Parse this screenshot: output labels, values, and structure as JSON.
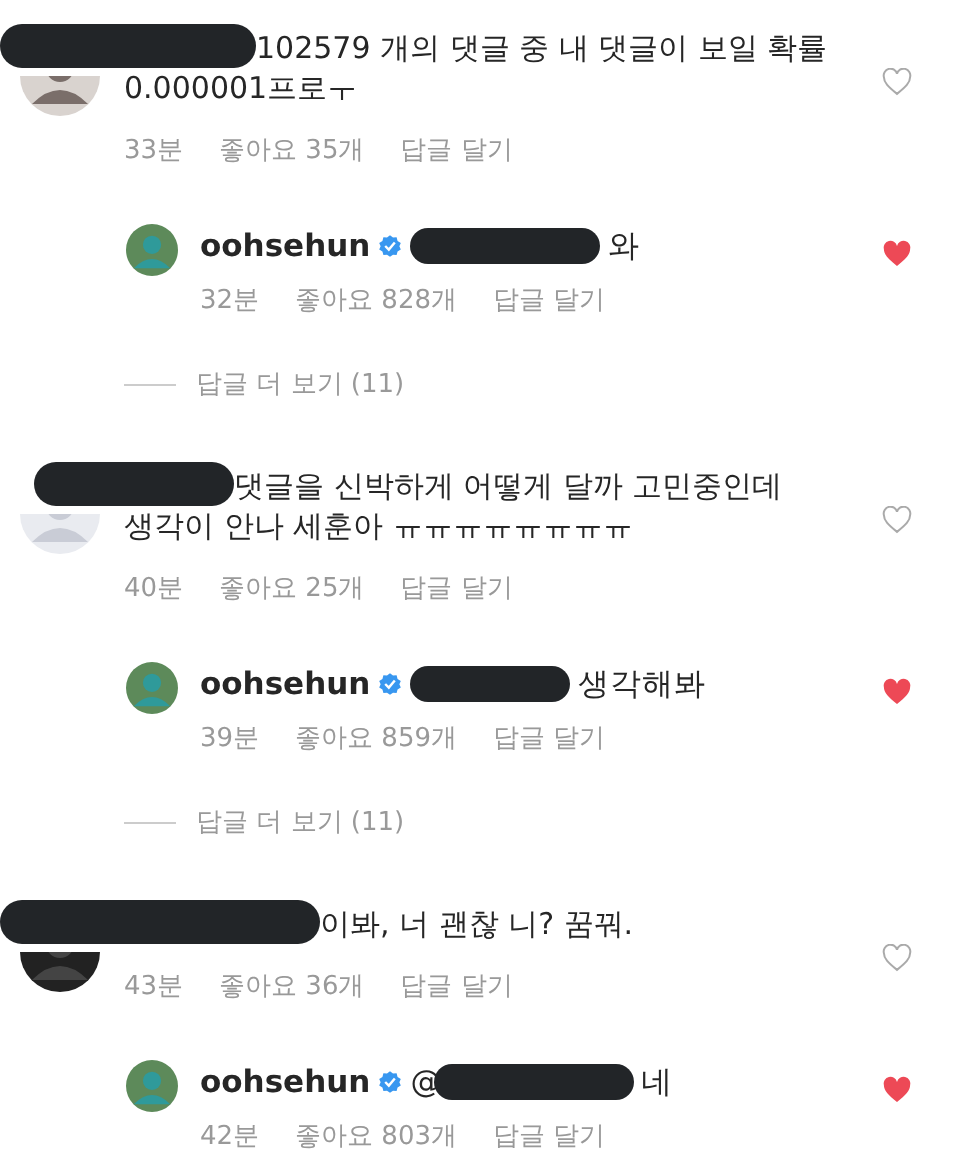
{
  "threads": [
    {
      "comment": {
        "text": "102579 개의 댓글 중 내 댓글이 보일 확률 0.000001프로ㅜ",
        "time": "33분",
        "likes": "좋아요 35개",
        "reply_label": "답글 달기",
        "liked": false
      },
      "reply": {
        "username": "oohsehun",
        "verified": true,
        "text": "와",
        "time": "32분",
        "likes": "좋아요 828개",
        "reply_label": "답글 달기",
        "liked": true
      },
      "more_replies": "답글 더 보기 (11)"
    },
    {
      "comment": {
        "text": "댓글을 신박하게 어떻게 달까 고민중인데 생각이 안나 세훈아 ㅠㅠㅠㅠㅠㅠㅠㅠ",
        "time": "40분",
        "likes": "좋아요 25개",
        "reply_label": "답글 달기",
        "liked": false
      },
      "reply": {
        "username": "oohsehun",
        "verified": true,
        "text": "생각해봐",
        "time": "39분",
        "likes": "좋아요 859개",
        "reply_label": "답글 달기",
        "liked": true
      },
      "more_replies": "답글 더 보기 (11)"
    },
    {
      "comment": {
        "text": "이봐, 너 괜찮 니? 꿈꿔.",
        "time": "43분",
        "likes": "좋아요 36개",
        "reply_label": "답글 달기",
        "liked": false
      },
      "reply": {
        "username": "oohsehun",
        "verified": true,
        "mention": "@",
        "text": "네",
        "time": "42분",
        "likes": "좋아요 803개",
        "reply_label": "답글 달기",
        "liked": true
      }
    }
  ]
}
